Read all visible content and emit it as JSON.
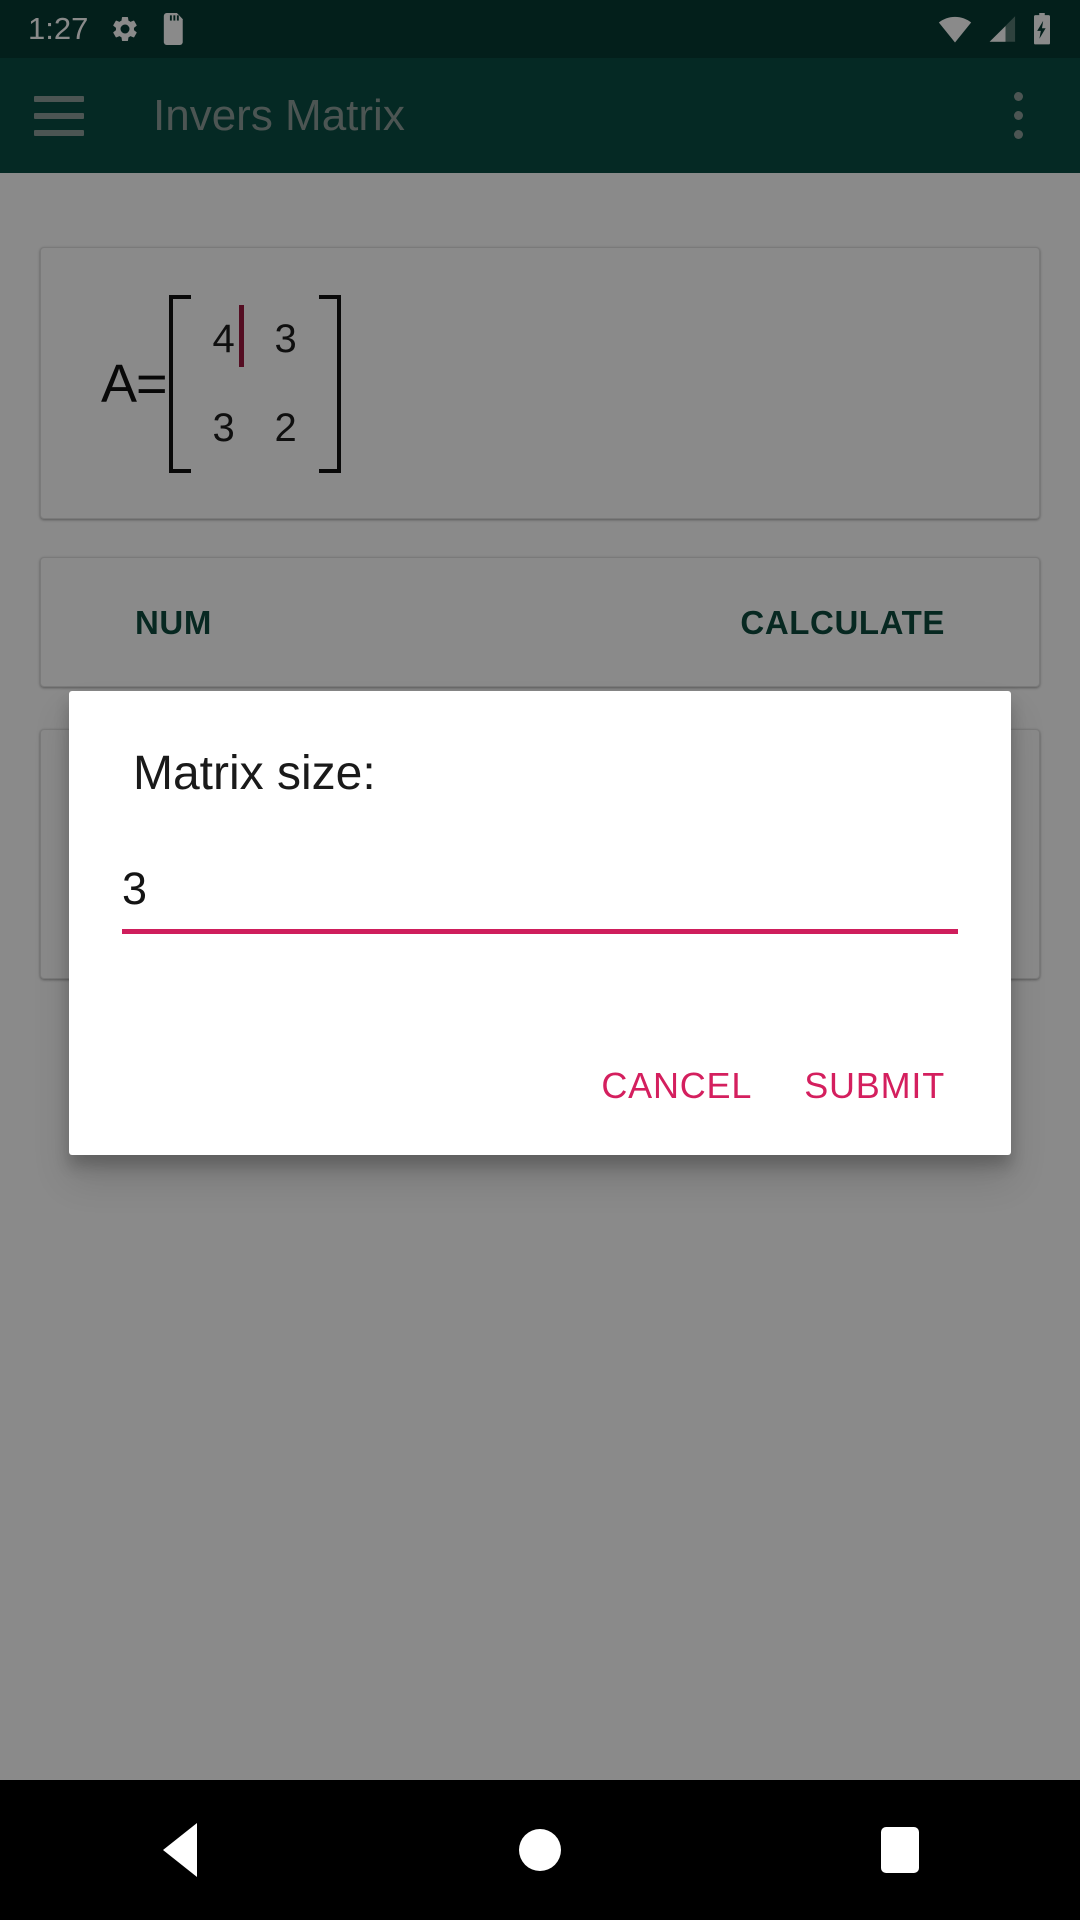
{
  "status_bar": {
    "time": "1:27",
    "left_icons": [
      "gear-icon",
      "sd-card-icon"
    ],
    "right_icons": [
      "wifi-icon",
      "cell-signal-icon",
      "battery-charging-icon"
    ],
    "background_color": "#063a33"
  },
  "app_bar": {
    "title": "Invers Matrix",
    "menu_icon": "hamburger-menu-icon",
    "overflow_icon": "overflow-menu-icon",
    "background_color": "#0b4d43",
    "foreground_color": "#8d9e99"
  },
  "matrix_card": {
    "label": "A=",
    "rows": [
      [
        "4",
        "3"
      ],
      [
        "3",
        "2"
      ]
    ],
    "focused_cell": {
      "row": 0,
      "col": 0
    },
    "cursor_color": "#9c1840"
  },
  "actions": {
    "num_label": "NUM",
    "calculate_label": "CALCULATE",
    "color": "#0d4a3d"
  },
  "dialog": {
    "title": "Matrix size:",
    "input_value": "3",
    "input_placeholder": "",
    "underline_color": "#cf1e5c",
    "cancel_label": "CANCEL",
    "submit_label": "SUBMIT",
    "button_color": "#d41f5e"
  },
  "nav_bar": {
    "back_icon": "back-triangle-icon",
    "home_icon": "home-circle-icon",
    "recents_icon": "recents-square-icon",
    "background_color": "#000000"
  }
}
